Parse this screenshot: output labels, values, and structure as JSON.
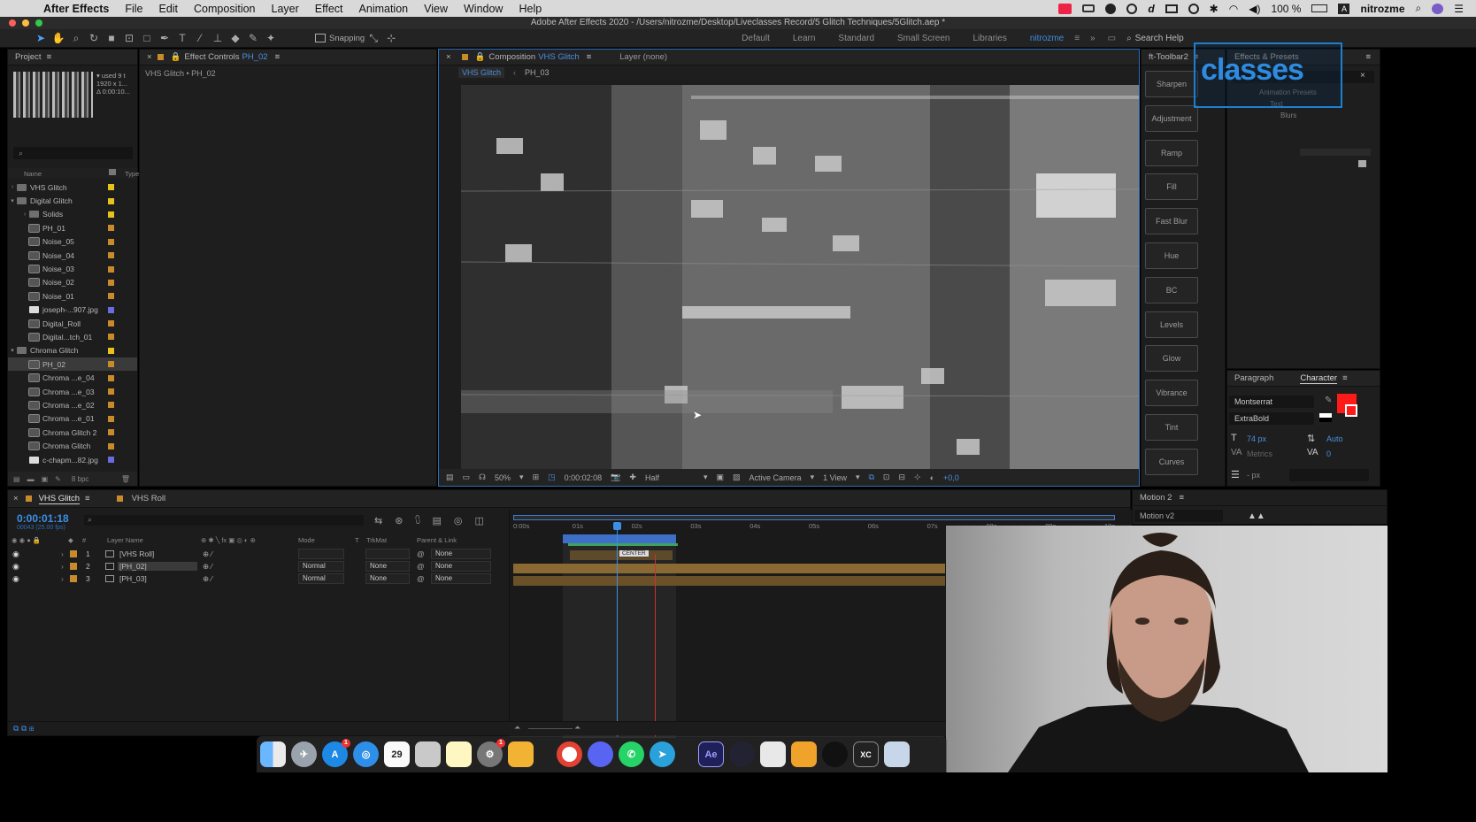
{
  "menubar": {
    "app": "After Effects",
    "items": [
      "File",
      "Edit",
      "Composition",
      "Layer",
      "Effect",
      "Animation",
      "View",
      "Window",
      "Help"
    ],
    "battery": "100 %",
    "user": "nitrozme"
  },
  "window": {
    "title": "Adobe After Effects 2020 - /Users/nitrozme/Desktop/Liveclasses Record/5 Glitch Techniques/5Glitch.aep *"
  },
  "toolbar": {
    "snapping": "Snapping",
    "workspaces": [
      "Default",
      "Learn",
      "Standard",
      "Small Screen",
      "Libraries",
      "nitrozme"
    ],
    "search_help": "Search Help"
  },
  "project": {
    "title": "Project",
    "info": [
      "▾ used 9 t",
      "1920 x 1...",
      "Δ 0:00:10..."
    ],
    "columns": {
      "name": "Name",
      "type": "Type"
    },
    "bpc": "8 bpc",
    "items": [
      {
        "label": "VHS Glitch",
        "kind": "folder",
        "indent": 0,
        "open": false,
        "color": "#e8c21a"
      },
      {
        "label": "Digital Glitch",
        "kind": "folder",
        "indent": 0,
        "open": true,
        "color": "#e8c21a"
      },
      {
        "label": "Solids",
        "kind": "folder",
        "indent": 1,
        "open": false,
        "color": "#e8c21a"
      },
      {
        "label": "PH_01",
        "kind": "comp",
        "indent": 1,
        "color": "#c98a2c"
      },
      {
        "label": "Noise_05",
        "kind": "comp",
        "indent": 1,
        "color": "#c98a2c"
      },
      {
        "label": "Noise_04",
        "kind": "comp",
        "indent": 1,
        "color": "#c98a2c"
      },
      {
        "label": "Noise_03",
        "kind": "comp",
        "indent": 1,
        "color": "#c98a2c"
      },
      {
        "label": "Noise_02",
        "kind": "comp",
        "indent": 1,
        "color": "#c98a2c"
      },
      {
        "label": "Noise_01",
        "kind": "comp",
        "indent": 1,
        "color": "#c98a2c"
      },
      {
        "label": "joseph-...907.jpg",
        "kind": "img",
        "indent": 1,
        "color": "#6b6bdd"
      },
      {
        "label": "Digital_Roll",
        "kind": "comp",
        "indent": 1,
        "color": "#c98a2c"
      },
      {
        "label": "Digital...tch_01",
        "kind": "comp",
        "indent": 1,
        "color": "#c98a2c"
      },
      {
        "label": "Chroma Glitch",
        "kind": "folder",
        "indent": 0,
        "open": true,
        "color": "#e8c21a"
      },
      {
        "label": "PH_02",
        "kind": "comp",
        "indent": 1,
        "color": "#c98a2c",
        "selected": true
      },
      {
        "label": "Chroma ...e_04",
        "kind": "comp",
        "indent": 1,
        "color": "#c98a2c"
      },
      {
        "label": "Chroma ...e_03",
        "kind": "comp",
        "indent": 1,
        "color": "#c98a2c"
      },
      {
        "label": "Chroma ...e_02",
        "kind": "comp",
        "indent": 1,
        "color": "#c98a2c"
      },
      {
        "label": "Chroma ...e_01",
        "kind": "comp",
        "indent": 1,
        "color": "#c98a2c"
      },
      {
        "label": "Chroma Glitch 2",
        "kind": "comp",
        "indent": 1,
        "color": "#c98a2c"
      },
      {
        "label": "Chroma Glitch",
        "kind": "comp",
        "indent": 1,
        "color": "#c98a2c"
      },
      {
        "label": "c-chapm...82.jpg",
        "kind": "img",
        "indent": 1,
        "color": "#6b6bdd"
      }
    ]
  },
  "effect_controls": {
    "tab_prefix": "Effect Controls",
    "tab_layer": "PH_02",
    "breadcrumb": "VHS Glitch • PH_02"
  },
  "composition": {
    "tab_prefix": "Composition",
    "tab_name": "VHS Glitch",
    "layer_tab": "Layer (none)",
    "subtabs": [
      "VHS Glitch",
      "PH_03"
    ],
    "zoom": "50%",
    "timecode": "0:00:02:08",
    "resolution": "Half",
    "camera": "Active Camera",
    "views": "1 View",
    "exposure": "+0,0"
  },
  "toolbar2": {
    "title": "ft-Toolbar2",
    "buttons": [
      "Sharpen",
      "Adjustment",
      "Ramp",
      "Fill",
      "Fast Blur",
      "Hue",
      "BC",
      "Levels",
      "Glow",
      "Vibrance",
      "Tint",
      "Curves"
    ]
  },
  "effects_presets": {
    "title": "Effects & Presets",
    "overlay_text": "classes",
    "tree": [
      "Animation Presets",
      "Text",
      "Blurs"
    ]
  },
  "character": {
    "tab_paragraph": "Paragraph",
    "tab_character": "Character",
    "font": "Montserrat",
    "style": "ExtraBold",
    "size": "74 px",
    "leading": "Auto",
    "kerning": "Metrics",
    "tracking": "0",
    "indent_unit": "- px",
    "fill_color": "#ff1a1a"
  },
  "timeline": {
    "tab_active": "VHS Glitch",
    "tab_other": "VHS Roll",
    "timecode": "0:00:01:18",
    "frames": "00043 (25.00 fps)",
    "headers": {
      "layer_name": "Layer Name",
      "mode": "Mode",
      "t": "T",
      "trkmat": "TrkMat",
      "parent": "Parent & Link"
    },
    "ruler": [
      "0:00s",
      "01s",
      "02s",
      "03s",
      "04s",
      "05s",
      "06s",
      "07s",
      "08s",
      "09s",
      "10s"
    ],
    "marker_label": "CENTER",
    "playhead_pct": 19.5,
    "layers": [
      {
        "num": "1",
        "name": "[VHS Roll]",
        "mode": "",
        "trkmat": "",
        "parent": "None",
        "selected": false
      },
      {
        "num": "2",
        "name": "[PH_02]",
        "mode": "Normal",
        "trkmat": "None",
        "parent": "None",
        "selected": true
      },
      {
        "num": "3",
        "name": "[PH_03]",
        "mode": "Normal",
        "trkmat": "None",
        "parent": "None",
        "selected": false
      }
    ]
  },
  "motion": {
    "title": "Motion 2",
    "version": "Motion v2"
  },
  "dock": {
    "calendar_day": "29",
    "ae_label": "Ae",
    "xc_label": "XC"
  }
}
